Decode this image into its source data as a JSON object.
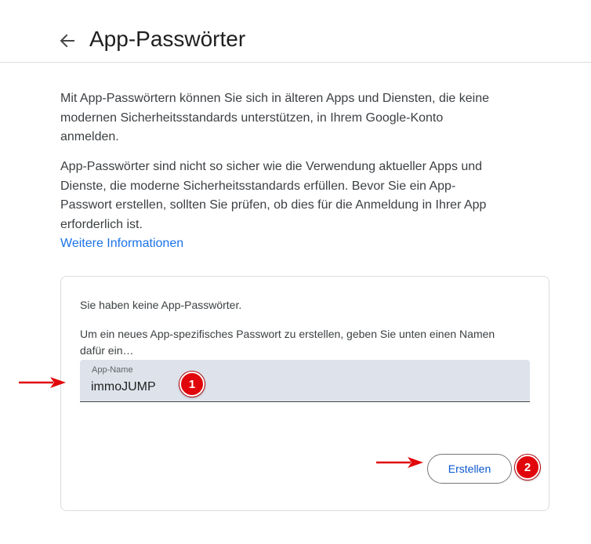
{
  "header": {
    "back_icon": "arrow-left-icon",
    "title": "App-Passwörter"
  },
  "intro": {
    "paragraph1": "Mit App-Passwörtern können Sie sich in älteren Apps und Diensten, die keine modernen Sicherheitsstandards unterstützen, in Ihrem Google-Konto anmelden.",
    "paragraph2": "App-Passwörter sind nicht so sicher wie die Verwendung aktueller Apps und Dienste, die moderne Sicherheitsstandards erfüllen. Bevor Sie ein App-Passwort erstellen, sollten Sie prüfen, ob dies für die Anmeldung in Ihrer App erforderlich ist.",
    "learn_more": "Weitere Informationen"
  },
  "card": {
    "no_passwords_text": "Sie haben keine App-Passwörter.",
    "instruction_text": "Um ein neues App-spezifisches Passwort zu erstellen, geben Sie unten einen Namen dafür ein…",
    "field": {
      "label": "App-Name",
      "value": "immoJUMP"
    },
    "create_button": "Erstellen"
  },
  "annotations": {
    "step1": "1",
    "step2": "2",
    "arrow_color": "#e0060b"
  },
  "colors": {
    "link": "#1a73e8",
    "button_text": "#0b57d0",
    "field_bg": "#dee3eb",
    "badge": "#e0060b"
  }
}
